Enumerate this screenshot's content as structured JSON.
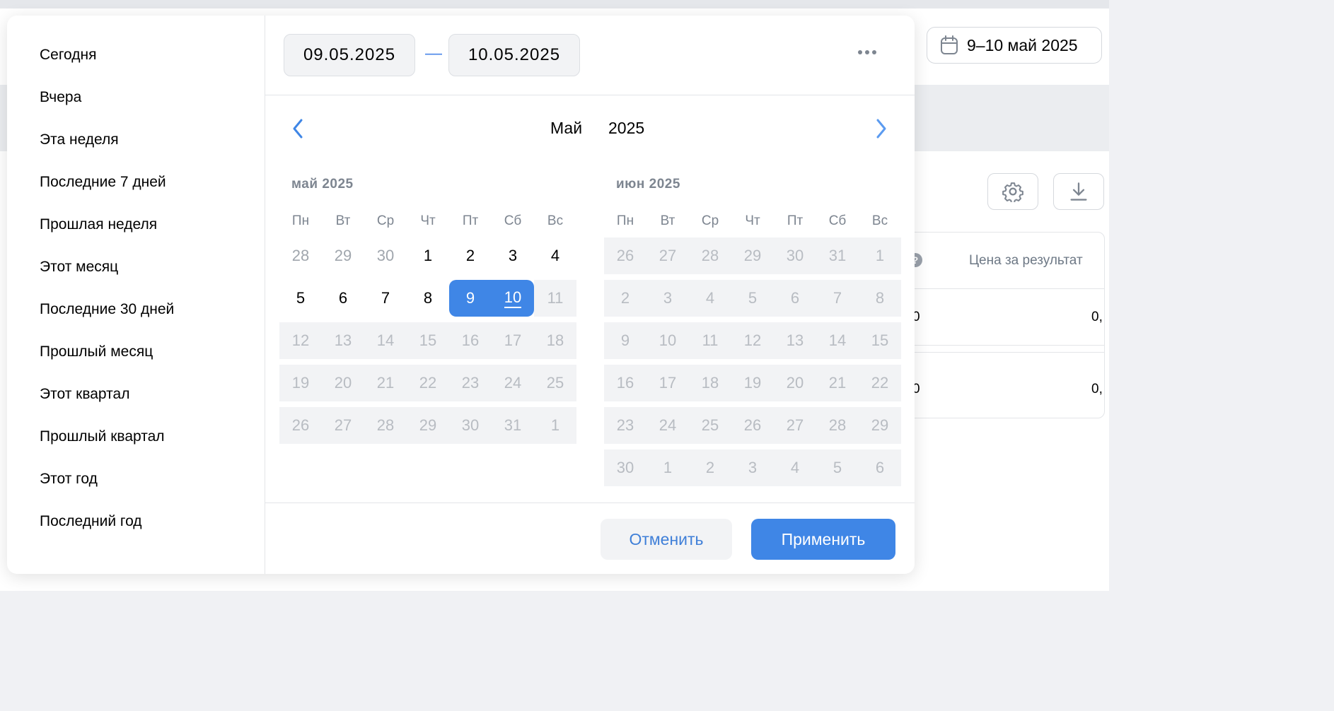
{
  "background": {
    "date_chip_label": "9–10 май 2025",
    "column_header": "Цена за результат",
    "row1": {
      "left": "0",
      "right": "0,"
    },
    "row2": {
      "left": "0",
      "right": "0,"
    }
  },
  "presets": [
    "Сегодня",
    "Вчера",
    "Эта неделя",
    "Последние 7 дней",
    "Прошлая неделя",
    "Этот месяц",
    "Последние 30 дней",
    "Прошлый месяц",
    "Этот квартал",
    "Прошлый квартал",
    "Этот год",
    "Последний год"
  ],
  "range": {
    "start": "09.05.2025",
    "end": "10.05.2025",
    "separator": "—"
  },
  "header": {
    "month": "Май",
    "year": "2025"
  },
  "weekdays": [
    "Пн",
    "Вт",
    "Ср",
    "Чт",
    "Пт",
    "Сб",
    "Вс"
  ],
  "calendars": [
    {
      "title": "май 2025",
      "weeks": [
        [
          {
            "d": "28",
            "s": "other"
          },
          {
            "d": "29",
            "s": "other"
          },
          {
            "d": "30",
            "s": "other"
          },
          {
            "d": "1",
            "s": "normal"
          },
          {
            "d": "2",
            "s": "normal"
          },
          {
            "d": "3",
            "s": "normal"
          },
          {
            "d": "4",
            "s": "normal"
          }
        ],
        [
          {
            "d": "5",
            "s": "normal"
          },
          {
            "d": "6",
            "s": "normal"
          },
          {
            "d": "7",
            "s": "normal"
          },
          {
            "d": "8",
            "s": "normal"
          },
          {
            "d": "9",
            "s": "selected"
          },
          {
            "d": "10",
            "s": "selected-today"
          },
          {
            "d": "11",
            "s": "disabled"
          }
        ],
        [
          {
            "d": "12",
            "s": "disabled"
          },
          {
            "d": "13",
            "s": "disabled"
          },
          {
            "d": "14",
            "s": "disabled"
          },
          {
            "d": "15",
            "s": "disabled"
          },
          {
            "d": "16",
            "s": "disabled"
          },
          {
            "d": "17",
            "s": "disabled"
          },
          {
            "d": "18",
            "s": "disabled"
          }
        ],
        [
          {
            "d": "19",
            "s": "disabled"
          },
          {
            "d": "20",
            "s": "disabled"
          },
          {
            "d": "21",
            "s": "disabled"
          },
          {
            "d": "22",
            "s": "disabled"
          },
          {
            "d": "23",
            "s": "disabled"
          },
          {
            "d": "24",
            "s": "disabled"
          },
          {
            "d": "25",
            "s": "disabled"
          }
        ],
        [
          {
            "d": "26",
            "s": "disabled"
          },
          {
            "d": "27",
            "s": "disabled"
          },
          {
            "d": "28",
            "s": "disabled"
          },
          {
            "d": "29",
            "s": "disabled"
          },
          {
            "d": "30",
            "s": "disabled"
          },
          {
            "d": "31",
            "s": "disabled"
          },
          {
            "d": "1",
            "s": "disabled"
          }
        ]
      ]
    },
    {
      "title": "июн 2025",
      "weeks": [
        [
          {
            "d": "26",
            "s": "disabled"
          },
          {
            "d": "27",
            "s": "disabled"
          },
          {
            "d": "28",
            "s": "disabled"
          },
          {
            "d": "29",
            "s": "disabled"
          },
          {
            "d": "30",
            "s": "disabled"
          },
          {
            "d": "31",
            "s": "disabled"
          },
          {
            "d": "1",
            "s": "disabled"
          }
        ],
        [
          {
            "d": "2",
            "s": "disabled"
          },
          {
            "d": "3",
            "s": "disabled"
          },
          {
            "d": "4",
            "s": "disabled"
          },
          {
            "d": "5",
            "s": "disabled"
          },
          {
            "d": "6",
            "s": "disabled"
          },
          {
            "d": "7",
            "s": "disabled"
          },
          {
            "d": "8",
            "s": "disabled"
          }
        ],
        [
          {
            "d": "9",
            "s": "disabled"
          },
          {
            "d": "10",
            "s": "disabled"
          },
          {
            "d": "11",
            "s": "disabled"
          },
          {
            "d": "12",
            "s": "disabled"
          },
          {
            "d": "13",
            "s": "disabled"
          },
          {
            "d": "14",
            "s": "disabled"
          },
          {
            "d": "15",
            "s": "disabled"
          }
        ],
        [
          {
            "d": "16",
            "s": "disabled"
          },
          {
            "d": "17",
            "s": "disabled"
          },
          {
            "d": "18",
            "s": "disabled"
          },
          {
            "d": "19",
            "s": "disabled"
          },
          {
            "d": "20",
            "s": "disabled"
          },
          {
            "d": "21",
            "s": "disabled"
          },
          {
            "d": "22",
            "s": "disabled"
          }
        ],
        [
          {
            "d": "23",
            "s": "disabled"
          },
          {
            "d": "24",
            "s": "disabled"
          },
          {
            "d": "25",
            "s": "disabled"
          },
          {
            "d": "26",
            "s": "disabled"
          },
          {
            "d": "27",
            "s": "disabled"
          },
          {
            "d": "28",
            "s": "disabled"
          },
          {
            "d": "29",
            "s": "disabled"
          }
        ],
        [
          {
            "d": "30",
            "s": "disabled"
          },
          {
            "d": "1",
            "s": "disabled"
          },
          {
            "d": "2",
            "s": "disabled"
          },
          {
            "d": "3",
            "s": "disabled"
          },
          {
            "d": "4",
            "s": "disabled"
          },
          {
            "d": "5",
            "s": "disabled"
          },
          {
            "d": "6",
            "s": "disabled"
          }
        ]
      ]
    }
  ],
  "footer": {
    "cancel": "Отменить",
    "apply": "Применить"
  },
  "colors": {
    "accent": "#3f86e6",
    "disabled_bg": "#f2f3f5",
    "muted_text": "#7d8590"
  },
  "icons": [
    "calendar-icon",
    "settings-icon",
    "download-icon",
    "help-icon",
    "more-icon",
    "chevron-left-icon",
    "chevron-right-icon"
  ]
}
